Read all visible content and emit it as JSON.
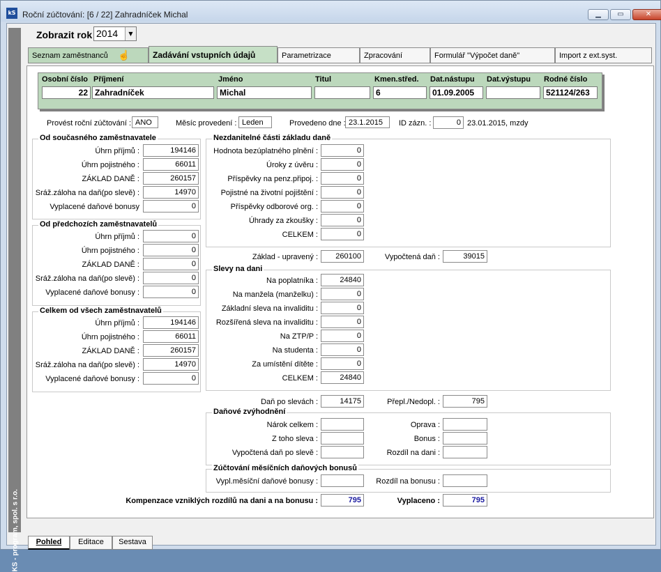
{
  "window": {
    "title": "Roční zúčtování: [6 / 22] Zahradníček Michal",
    "app_icon": "kS"
  },
  "sidebar_text": "KS - program, spol. s r.o.",
  "year": {
    "label": "Zobrazit rok",
    "value": "2014"
  },
  "tabs": [
    {
      "label": "Seznam zaměstnanců",
      "icon": "hand-icon"
    },
    {
      "label": "Zadávání vstupních údajů"
    },
    {
      "label": "Parametrizace"
    },
    {
      "label": "Zpracování"
    },
    {
      "label": "Formulář \"Výpočet daně\""
    },
    {
      "label": "Import z ext.syst."
    }
  ],
  "employee": {
    "labels": {
      "os_cislo": "Osobní číslo",
      "prijmeni": "Příjmení",
      "jmeno": "Jméno",
      "titul": "Titul",
      "kmen": "Kmen.střed.",
      "nastup": "Dat.nástupu",
      "vystup": "Dat.výstupu",
      "rc": "Rodné číslo"
    },
    "values": {
      "os_cislo": "22",
      "prijmeni": "Zahradníček",
      "jmeno": "Michal",
      "titul": "",
      "kmen": "6",
      "nastup": "01.09.2005",
      "vystup": "",
      "rc": "521124/263"
    }
  },
  "info": {
    "provest_label": "Provést roční zúčtování :",
    "provest_value": "ANO",
    "mesic_label": "Měsíc provedení :",
    "mesic_value": "Leden",
    "provedeno_label": "Provedeno dne :",
    "provedeno_value": "23.1.2015",
    "id_label": "ID zázn. :",
    "id_value": "0",
    "stamp": "23.01.2015, mzdy"
  },
  "current_employer": {
    "title": "Od současného zaměstnavatele",
    "rows": [
      {
        "label": "Úhrn příjmů :",
        "value": "194146"
      },
      {
        "label": "Úhrn pojistného :",
        "value": "66011"
      },
      {
        "label": "ZÁKLAD DANĚ :",
        "value": "260157"
      },
      {
        "label": "Sráž.záloha na daň(po slevě) :",
        "value": "14970"
      },
      {
        "label": "Vyplacené daňové bonusy",
        "value": "0"
      }
    ]
  },
  "previous_employers": {
    "title": "Od předchozích zaměstnavatelů",
    "rows": [
      {
        "label": "Úhrn příjmů :",
        "value": "0"
      },
      {
        "label": "Úhrn pojistného :",
        "value": "0"
      },
      {
        "label": "ZÁKLAD DANĚ :",
        "value": "0"
      },
      {
        "label": "Sráž.záloha na daň(po slevě) :",
        "value": "0"
      },
      {
        "label": "Vyplacené daňové bonusy :",
        "value": "0"
      }
    ]
  },
  "all_employers": {
    "title": "Celkem od všech zaměstnavatelů",
    "rows": [
      {
        "label": "Úhrn příjmů :",
        "value": "194146"
      },
      {
        "label": "Úhrn pojistného :",
        "value": "66011"
      },
      {
        "label": "ZÁKLAD DANĚ :",
        "value": "260157"
      },
      {
        "label": "Sráž.záloha na daň(po slevě) :",
        "value": "14970"
      },
      {
        "label": "Vyplacené daňové bonusy :",
        "value": "0"
      }
    ]
  },
  "nezdanitelne": {
    "title": "Nezdanitelné části základu daně",
    "rows": [
      {
        "label": "Hodnota bezúplatného plnění :",
        "value": "0"
      },
      {
        "label": "Úroky z úvěru :",
        "value": "0"
      },
      {
        "label": "Příspěvky na penz.připoj. :",
        "value": "0"
      },
      {
        "label": "Pojistné na životní pojištění :",
        "value": "0"
      },
      {
        "label": "Příspěvky odborové org. :",
        "value": "0"
      },
      {
        "label": "Úhrady za zkoušky :",
        "value": "0"
      },
      {
        "label": "CELKEM :",
        "value": "0"
      }
    ]
  },
  "zaklad": {
    "label": "Základ - upravený :",
    "value": "260100",
    "dan_label": "Vypočtená daň :",
    "dan_value": "39015"
  },
  "slevy": {
    "title": "Slevy na dani",
    "rows": [
      {
        "label": "Na poplatníka :",
        "value": "24840"
      },
      {
        "label": "Na  manžela (manželku) :",
        "value": "0"
      },
      {
        "label": "Základní sleva na invaliditu :",
        "value": "0"
      },
      {
        "label": "Rozšířená sleva na invaliditu :",
        "value": "0"
      },
      {
        "label": "Na ZTP/P :",
        "value": "0"
      },
      {
        "label": "Na studenta :",
        "value": "0"
      },
      {
        "label": "Za umístění dítěte :",
        "value": "0"
      },
      {
        "label": "CELKEM :",
        "value": "24840"
      }
    ]
  },
  "dan_po_slevach": {
    "label": "Daň po slevách :",
    "value": "14175",
    "prepl_label": "Přepl./Nedopl. :",
    "prepl_value": "795"
  },
  "zvyhodneni": {
    "title": "Daňové zvýhodnění",
    "left": [
      {
        "label": "Nárok celkem :",
        "value": ""
      },
      {
        "label": "Z toho sleva :",
        "value": ""
      },
      {
        "label": "Vypočtená daň po slevě :",
        "value": ""
      }
    ],
    "right": [
      {
        "label": "Oprava :",
        "value": ""
      },
      {
        "label": "Bonus :",
        "value": ""
      },
      {
        "label": "Rozdíl na dani :",
        "value": ""
      }
    ]
  },
  "zuctovani": {
    "title": "Zúčtování měsíčních daňových bonusů",
    "left_label": "Vypl.měsíční daňové bonusy :",
    "left_value": "",
    "right_label": "Rozdíl na bonusu :",
    "right_value": ""
  },
  "kompenzace": {
    "label": "Kompenzace vzniklých rozdílů na dani a na bonusu :",
    "value": "795",
    "vypl_label": "Vyplaceno :",
    "vypl_value": "795"
  },
  "bottom_tabs": [
    "Pohled",
    "Editace",
    "Sestava"
  ]
}
